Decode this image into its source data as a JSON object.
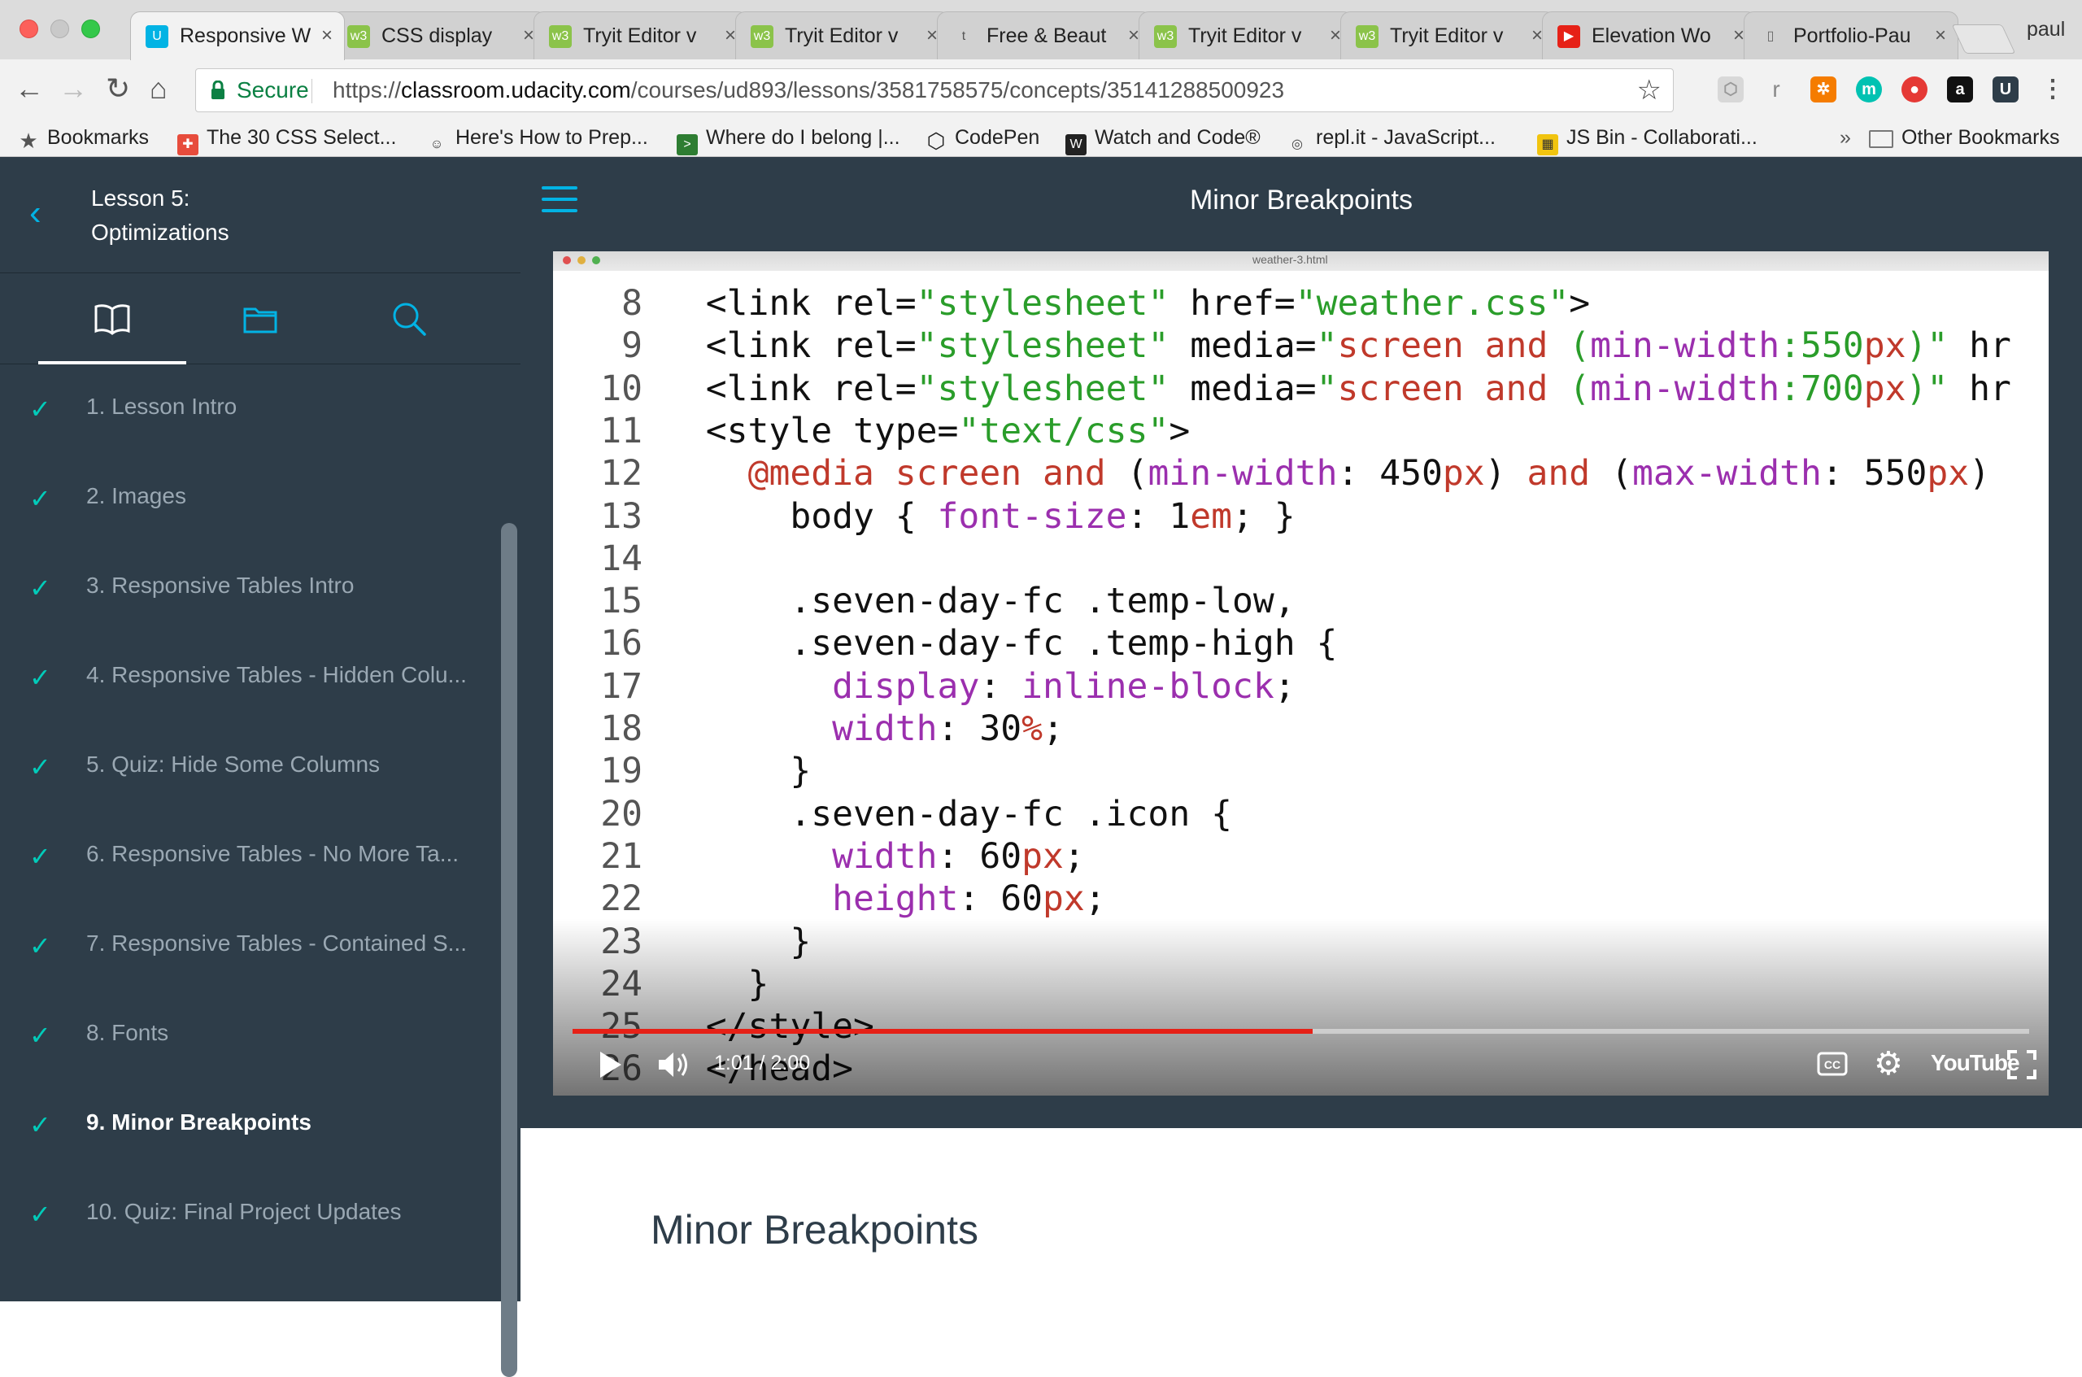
{
  "browser": {
    "tabs": [
      {
        "title": "Responsive W",
        "icon": "udacity-icon",
        "active": true
      },
      {
        "title": "CSS display",
        "icon": "w3schools-icon"
      },
      {
        "title": "Tryit Editor v",
        "icon": "w3schools-icon"
      },
      {
        "title": "Tryit Editor v",
        "icon": "w3schools-icon"
      },
      {
        "title": "Free & Beaut",
        "icon": "tumblr-icon"
      },
      {
        "title": "Tryit Editor v",
        "icon": "w3schools-icon"
      },
      {
        "title": "Tryit Editor v",
        "icon": "w3schools-icon"
      },
      {
        "title": "Elevation Wo",
        "icon": "youtube-icon"
      },
      {
        "title": "Portfolio-Pau",
        "icon": "document-icon"
      }
    ],
    "profile_name": "paul",
    "security_label": "Secure",
    "url_scheme": "https://",
    "url_host": "classroom.udacity.com",
    "url_path": "/courses/ud893/lessons/3581758575/concepts/35141288500923",
    "extension_letter": "r",
    "bookmarks": [
      {
        "label": "Bookmarks",
        "icon": "star-icon"
      },
      {
        "label": "The 30 CSS Select...",
        "icon": "tutsplus-icon"
      },
      {
        "label": "Here's How to Prep...",
        "icon": "reddit-icon"
      },
      {
        "label": "Where do I belong |...",
        "icon": "terminal-icon"
      },
      {
        "label": "CodePen",
        "icon": "codepen-icon"
      },
      {
        "label": "Watch and Code®",
        "icon": "watchandcode-icon"
      },
      {
        "label": "repl.it - JavaScript...",
        "icon": "replit-icon"
      },
      {
        "label": "JS Bin - Collaborati...",
        "icon": "jsbin-icon"
      }
    ],
    "bookmarks_overflow": "»",
    "other_bookmarks": "Other Bookmarks"
  },
  "sidebar": {
    "lesson_number": "Lesson 5:",
    "lesson_name": "Optimizations",
    "items": [
      {
        "label": "1. Lesson Intro",
        "done": true
      },
      {
        "label": "2. Images",
        "done": true
      },
      {
        "label": "3. Responsive Tables Intro",
        "done": true
      },
      {
        "label": "4. Responsive Tables - Hidden Colu...",
        "done": true
      },
      {
        "label": "5. Quiz: Hide Some Columns",
        "done": true
      },
      {
        "label": "6. Responsive Tables - No More Ta...",
        "done": true
      },
      {
        "label": "7. Responsive Tables - Contained S...",
        "done": true
      },
      {
        "label": "8. Fonts",
        "done": true
      },
      {
        "label": "9. Minor Breakpoints",
        "done": true,
        "current": true
      },
      {
        "label": "10. Quiz: Final Project Updates",
        "done": true
      }
    ]
  },
  "main": {
    "concept_title": "Minor Breakpoints",
    "content_heading": "Minor Breakpoints"
  },
  "video": {
    "window_title": "weather-3.html",
    "time": "1:01 / 2:00",
    "progress": 0.508,
    "youtube_label": "YouTube",
    "code_lines": [
      {
        "n": "8",
        "text": "  <link rel=\"stylesheet\" href=\"weather.css\">"
      },
      {
        "n": "9",
        "text": "  <link rel=\"stylesheet\" media=\"screen and (min-width:550px)\" hr"
      },
      {
        "n": "10",
        "text": "  <link rel=\"stylesheet\" media=\"screen and (min-width:700px)\" hr"
      },
      {
        "n": "11",
        "text": "  <style type=\"text/css\">"
      },
      {
        "n": "12",
        "text": "    @media screen and (min-width: 450px) and (max-width: 550px)"
      },
      {
        "n": "13",
        "text": "      body { font-size: 1em; }"
      },
      {
        "n": "14",
        "text": ""
      },
      {
        "n": "15",
        "text": "      .seven-day-fc .temp-low,"
      },
      {
        "n": "16",
        "text": "      .seven-day-fc .temp-high {"
      },
      {
        "n": "17",
        "text": "        display: inline-block;"
      },
      {
        "n": "18",
        "text": "        width: 30%;"
      },
      {
        "n": "19",
        "text": "      }"
      },
      {
        "n": "20",
        "text": "      .seven-day-fc .icon {"
      },
      {
        "n": "21",
        "text": "        width: 60px;"
      },
      {
        "n": "22",
        "text": "        height: 60px;"
      },
      {
        "n": "23",
        "text": "      }"
      },
      {
        "n": "24",
        "text": "    }"
      },
      {
        "n": "25",
        "text": "  </style>"
      },
      {
        "n": "26",
        "text": "  </head>"
      }
    ]
  },
  "colors": {
    "sidebar_bg": "#2e3d49",
    "accent": "#02b3e4",
    "check": "#02ccba",
    "progress": "#e62117"
  }
}
